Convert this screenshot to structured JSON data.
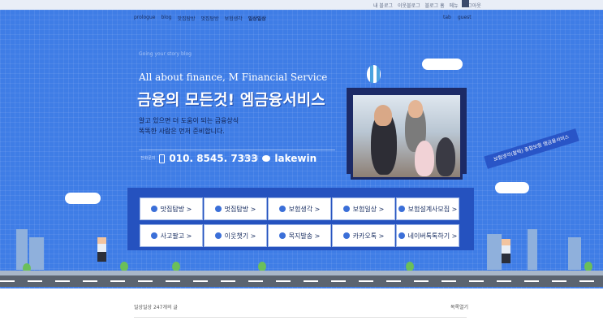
{
  "top_links": [
    "내 블로그",
    "이웃블로그",
    "블로그 홈",
    "메뉴",
    "로그아웃"
  ],
  "nav": {
    "items": [
      "prologue",
      "blog",
      "맛집탐방",
      "멋집탐방",
      "보험생각",
      "일상일상"
    ],
    "right": [
      "tab",
      "guest"
    ]
  },
  "header": {
    "subtitle": "Going your story blog",
    "en_title": "All about finance, M Financial Service",
    "ko_title": "금융의 모든것! 엠금융서비스",
    "desc_line1": "알고 있으면 더 도움이 되는 금융상식",
    "desc_line2": "똑똑한 사람은 먼저 준비합니다."
  },
  "contact": {
    "phone_label": "전화문의",
    "phone_number": "010. 8545. 7333",
    "kakao_label": "카카오톡",
    "kakao_id": "lakewin"
  },
  "banner": {
    "text": "보험생각(찰떡) 종합보험 엠금융서비스"
  },
  "menu": {
    "row1": [
      "맛집탐방 >",
      "멋집탐방 >",
      "보험생각 >",
      "보험일상 >",
      "보험설계사모집 >"
    ],
    "row2": [
      "사고팔고 >",
      "이웃챗기 >",
      "목지발송 >",
      "카카오톡 >",
      "네이버톡톡하기 >"
    ]
  },
  "footer": {
    "post_label": "일상일상 247개의 글",
    "list_toggle": "목록열기"
  },
  "colors": {
    "hero": "#3f7de6",
    "menu_panel": "#2552bf",
    "title_text": "#ffffff"
  }
}
